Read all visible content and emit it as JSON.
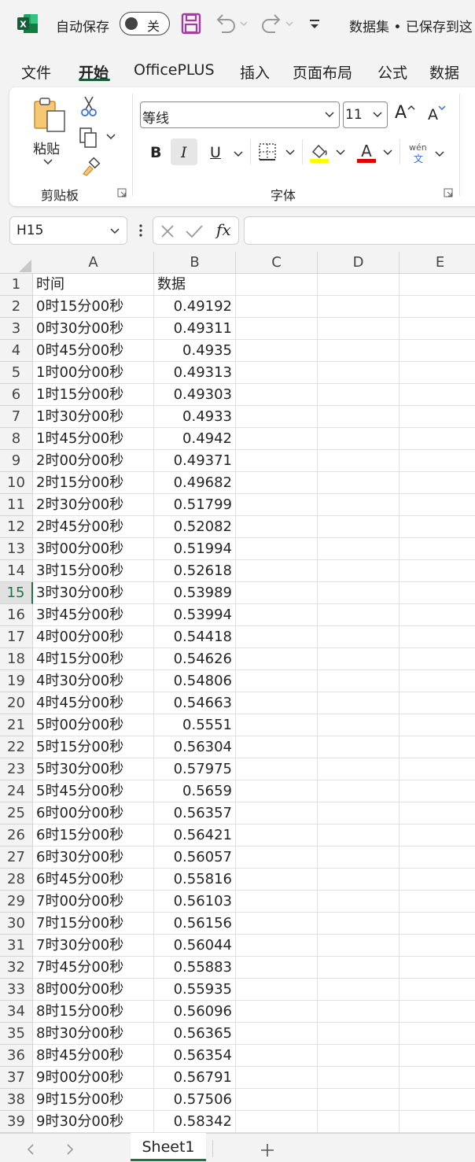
{
  "titlebar": {
    "autosave_label": "自动保存",
    "autosave_state": "关",
    "doc_title": "数据集 • 已保存到这"
  },
  "ribbon_tabs": [
    "文件",
    "开始",
    "OfficePLUS",
    "插入",
    "页面布局",
    "公式",
    "数据"
  ],
  "ribbon": {
    "clipboard_group": "剪贴板",
    "paste_label": "粘贴",
    "font_group": "字体",
    "font_name": "等线",
    "font_size": "11",
    "bold": "B",
    "italic": "I",
    "underline": "U",
    "grow_font": "A",
    "shrink_font": "A",
    "phonetic": "wén",
    "phonetic_sub": "文"
  },
  "formula_bar": {
    "name_box": "H15",
    "fx": "fx",
    "formula": ""
  },
  "grid": {
    "columns": [
      "A",
      "B",
      "C",
      "D",
      "E"
    ],
    "active_row": 15,
    "rows": [
      {
        "n": "1",
        "a": "时间",
        "b": "数据"
      },
      {
        "n": "2",
        "a": "0时15分00秒",
        "b": "0.49192"
      },
      {
        "n": "3",
        "a": "0时30分00秒",
        "b": "0.49311"
      },
      {
        "n": "4",
        "a": "0时45分00秒",
        "b": "0.4935"
      },
      {
        "n": "5",
        "a": "1时00分00秒",
        "b": "0.49313"
      },
      {
        "n": "6",
        "a": "1时15分00秒",
        "b": "0.49303"
      },
      {
        "n": "7",
        "a": "1时30分00秒",
        "b": "0.4933"
      },
      {
        "n": "8",
        "a": "1时45分00秒",
        "b": "0.4942"
      },
      {
        "n": "9",
        "a": "2时00分00秒",
        "b": "0.49371"
      },
      {
        "n": "10",
        "a": "2时15分00秒",
        "b": "0.49682"
      },
      {
        "n": "11",
        "a": "2时30分00秒",
        "b": "0.51799"
      },
      {
        "n": "12",
        "a": "2时45分00秒",
        "b": "0.52082"
      },
      {
        "n": "13",
        "a": "3时00分00秒",
        "b": "0.51994"
      },
      {
        "n": "14",
        "a": "3时15分00秒",
        "b": "0.52618"
      },
      {
        "n": "15",
        "a": "3时30分00秒",
        "b": "0.53989"
      },
      {
        "n": "16",
        "a": "3时45分00秒",
        "b": "0.53994"
      },
      {
        "n": "17",
        "a": "4时00分00秒",
        "b": "0.54418"
      },
      {
        "n": "18",
        "a": "4时15分00秒",
        "b": "0.54626"
      },
      {
        "n": "19",
        "a": "4时30分00秒",
        "b": "0.54806"
      },
      {
        "n": "20",
        "a": "4时45分00秒",
        "b": "0.54663"
      },
      {
        "n": "21",
        "a": "5时00分00秒",
        "b": "0.5551"
      },
      {
        "n": "22",
        "a": "5时15分00秒",
        "b": "0.56304"
      },
      {
        "n": "23",
        "a": "5时30分00秒",
        "b": "0.57975"
      },
      {
        "n": "24",
        "a": "5时45分00秒",
        "b": "0.5659"
      },
      {
        "n": "25",
        "a": "6时00分00秒",
        "b": "0.56357"
      },
      {
        "n": "26",
        "a": "6时15分00秒",
        "b": "0.56421"
      },
      {
        "n": "27",
        "a": "6时30分00秒",
        "b": "0.56057"
      },
      {
        "n": "28",
        "a": "6时45分00秒",
        "b": "0.55816"
      },
      {
        "n": "29",
        "a": "7时00分00秒",
        "b": "0.56103"
      },
      {
        "n": "30",
        "a": "7时15分00秒",
        "b": "0.56156"
      },
      {
        "n": "31",
        "a": "7时30分00秒",
        "b": "0.56044"
      },
      {
        "n": "32",
        "a": "7时45分00秒",
        "b": "0.55883"
      },
      {
        "n": "33",
        "a": "8时00分00秒",
        "b": "0.55935"
      },
      {
        "n": "34",
        "a": "8时15分00秒",
        "b": "0.56096"
      },
      {
        "n": "35",
        "a": "8时30分00秒",
        "b": "0.56365"
      },
      {
        "n": "36",
        "a": "8时45分00秒",
        "b": "0.56354"
      },
      {
        "n": "37",
        "a": "9时00分00秒",
        "b": "0.56791"
      },
      {
        "n": "38",
        "a": "9时15分00秒",
        "b": "0.57506"
      },
      {
        "n": "39",
        "a": "9时30分00秒",
        "b": "0.58342"
      }
    ]
  },
  "sheet_tabs": [
    "Sheet1"
  ],
  "colors": {
    "accent": "#217346",
    "save_icon": "#a23ea0",
    "highlight": "#ffff00",
    "font_color": "#e00000"
  }
}
